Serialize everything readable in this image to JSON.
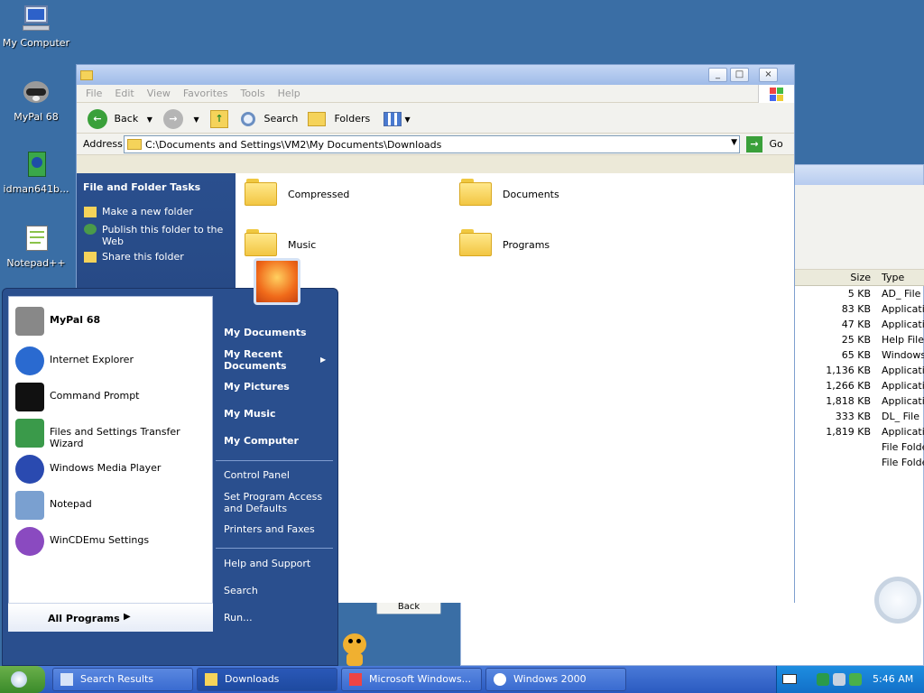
{
  "desktop": {
    "icons": [
      {
        "label": "My Computer"
      },
      {
        "label": "MyPal 68"
      },
      {
        "label": "idman641b..."
      },
      {
        "label": "Notepad++"
      }
    ]
  },
  "explorer": {
    "menu": [
      "File",
      "Edit",
      "View",
      "Favorites",
      "Tools",
      "Help"
    ],
    "toolbar": {
      "back": "Back",
      "search": "Search",
      "folders": "Folders"
    },
    "address": {
      "label": "Address",
      "value": "C:\\Documents and Settings\\VM2\\My Documents\\Downloads",
      "go": "Go"
    },
    "tasks": {
      "title": "File and Folder Tasks",
      "items": [
        "Make a new folder",
        "Publish this folder to the Web",
        "Share this folder"
      ]
    },
    "folders": [
      "Compressed",
      "Documents",
      "Music",
      "Programs"
    ]
  },
  "background_window": {
    "columns": {
      "size": "Size",
      "type": "Type"
    },
    "rows": [
      {
        "size": "5 KB",
        "type": "AD_ File"
      },
      {
        "size": "83 KB",
        "type": "Applicatio"
      },
      {
        "size": "47 KB",
        "type": "Applicatio"
      },
      {
        "size": "25 KB",
        "type": "Help File"
      },
      {
        "size": "65 KB",
        "type": "Windows"
      },
      {
        "size": "1,136 KB",
        "type": "Applicatio"
      },
      {
        "size": "1,266 KB",
        "type": "Applicatio"
      },
      {
        "size": "1,818 KB",
        "type": "Applicatio"
      },
      {
        "size": "333 KB",
        "type": "DL_ File"
      },
      {
        "size": "1,819 KB",
        "type": "Applicatio"
      },
      {
        "size": "",
        "type": "File Folde"
      },
      {
        "size": "",
        "type": "File Folde"
      }
    ],
    "back_button": "Back"
  },
  "start_menu": {
    "left_items": [
      "MyPal 68",
      "Internet Explorer",
      "Command Prompt",
      "Files and Settings Transfer Wizard",
      "Windows Media Player",
      "Notepad",
      "WinCDEmu Settings"
    ],
    "all_programs": "All Programs",
    "right_bold": [
      "My Documents",
      "My Recent Documents",
      "My Pictures",
      "My Music",
      "My Computer"
    ],
    "right_normal_1": [
      "Control Panel",
      "Set Program Access and Defaults",
      "Printers and Faxes"
    ],
    "right_normal_2": [
      "Help and Support",
      "Search",
      "Run..."
    ]
  },
  "taskbar": {
    "buttons": [
      "Search Results",
      "Downloads",
      "Microsoft Windows...",
      "Windows 2000"
    ],
    "clock": "5:46 AM"
  }
}
